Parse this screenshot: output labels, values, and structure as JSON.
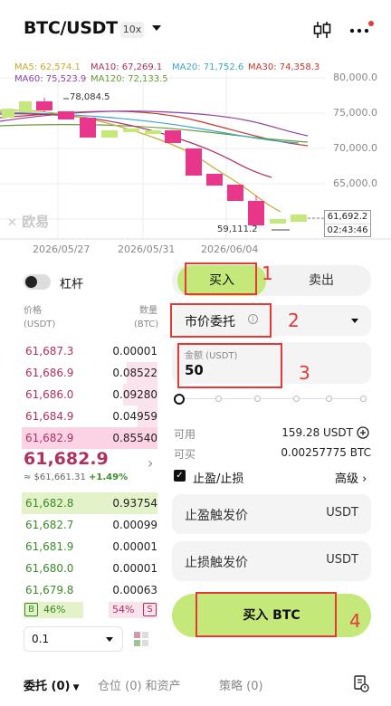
{
  "header": {
    "pair": "BTC/USDT",
    "leverage": "10x"
  },
  "chart": {
    "ma": [
      {
        "label": "MA5: 62,574.1",
        "color": "#c8a832"
      },
      {
        "label": "MA10: 67,269.1",
        "color": "#b03060"
      },
      {
        "label": "MA20: 71,752.6",
        "color": "#3aa8c8"
      },
      {
        "label": "MA30: 74,358.3",
        "color": "#c0392b"
      },
      {
        "label": "MA60: 75,523.9",
        "color": "#8e44ad"
      },
      {
        "label": "MA120: 72,133.5",
        "color": "#6b9b3a"
      }
    ],
    "y_ticks": [
      "80,000.0",
      "75,000.0",
      "70,000.0",
      "65,000.0"
    ],
    "x_ticks": [
      "2026/05/27",
      "2026/05/31",
      "2026/06/04"
    ],
    "high_label": "78,084.5",
    "low_label": "59,111.2",
    "current_price": "61,692.2",
    "countdown": "02:43:46",
    "watermark": "欧易"
  },
  "left": {
    "leverage_label": "杠杆",
    "price_header": "价格",
    "price_unit": "(USDT)",
    "qty_header": "数量",
    "qty_unit": "(BTC)",
    "asks": [
      {
        "price": "61,687.3",
        "qty": "0.00001"
      },
      {
        "price": "61,686.9",
        "qty": "0.08522"
      },
      {
        "price": "61,686.0",
        "qty": "0.09280"
      },
      {
        "price": "61,684.9",
        "qty": "0.04959"
      },
      {
        "price": "61,682.9",
        "qty": "0.85540"
      }
    ],
    "last_price": "61,682.9",
    "last_price_usd": "≈ $61,661.31",
    "change": "+1.49%",
    "bids": [
      {
        "price": "61,682.8",
        "qty": "0.93754"
      },
      {
        "price": "61,682.7",
        "qty": "0.00099"
      },
      {
        "price": "61,681.9",
        "qty": "0.00001"
      },
      {
        "price": "61,680.0",
        "qty": "0.00001"
      },
      {
        "price": "61,679.8",
        "qty": "0.00063"
      }
    ],
    "buy_ratio_badge": "B",
    "buy_ratio": "46%",
    "sell_ratio": "54%",
    "sell_ratio_badge": "S",
    "depth_step": "0.1"
  },
  "right": {
    "buy_tab": "买入",
    "sell_tab": "卖出",
    "order_type": "市价委托",
    "amount_label": "金额 (USDT)",
    "amount_value": "50",
    "available_label": "可用",
    "available_value": "159.28 USDT",
    "can_buy_label": "可买",
    "can_buy_value": "0.00257775 BTC",
    "tp_sl_label": "止盈/止损",
    "advanced_label": "高级",
    "tp_trigger_label": "止盈触发价",
    "tp_unit": "USDT",
    "sl_trigger_label": "止损触发价",
    "sl_unit": "USDT",
    "buy_button": "买入 BTC",
    "annotations": [
      "1",
      "2",
      "3",
      "4"
    ]
  },
  "bottom": {
    "tab_orders": "委托 (0)",
    "tab_positions": "仓位 (0) 和资产",
    "tab_strategy": "策略 (0)"
  },
  "colors": {
    "green": "#c5e87a",
    "red_candle": "#e8378a",
    "annotation": "#e53935"
  }
}
